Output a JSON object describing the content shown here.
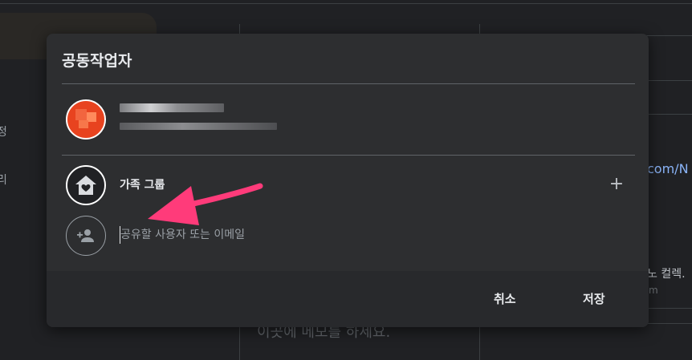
{
  "background": {
    "side_labels": [
      "정",
      "리"
    ],
    "right_link": "com/N",
    "right_text": "노 컬렉.",
    "right_sub": "m",
    "bottom_text": "이곳에 메모를 하세요."
  },
  "dialog": {
    "title": "공동작업자",
    "owner": {
      "avatar_color": "#e8431f"
    },
    "family_group": {
      "label": "가족 그룹",
      "add_icon": "plus-icon"
    },
    "share_input": {
      "value": "",
      "placeholder": "공유할 사용자 또는 이메일"
    },
    "buttons": {
      "cancel": "취소",
      "save": "저장"
    }
  },
  "colors": {
    "dialog_bg": "#2d2e30",
    "page_bg": "#202124",
    "annotation_arrow": "#ff3b7a"
  }
}
